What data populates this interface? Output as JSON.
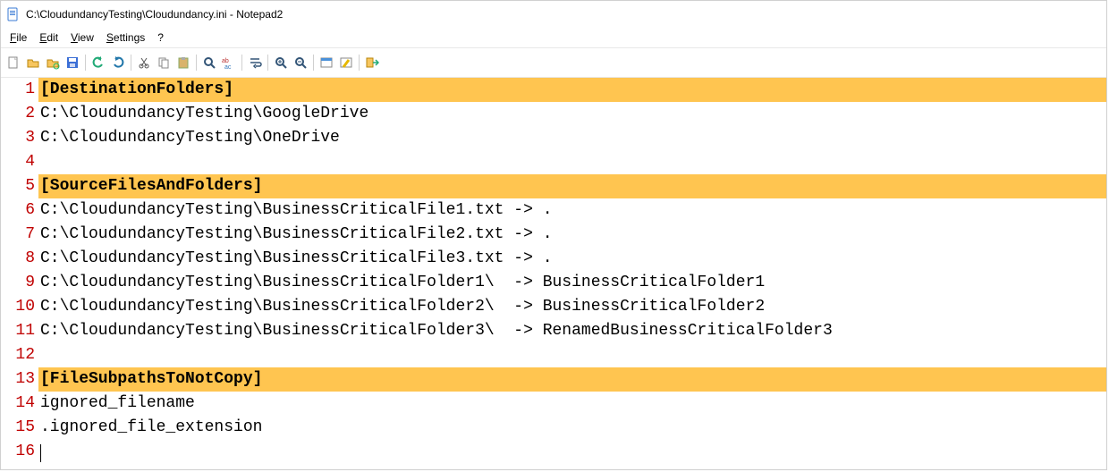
{
  "titlebar": {
    "title": "C:\\CloudundancyTesting\\Cloudundancy.ini - Notepad2"
  },
  "menubar": {
    "file": "File",
    "edit": "Edit",
    "view": "View",
    "settings": "Settings",
    "help": "?"
  },
  "tool_icons": {
    "new": "new-file-icon",
    "open": "open-file-icon",
    "browse": "browse-icon",
    "save": "save-icon",
    "undo": "undo-icon",
    "redo": "redo-icon",
    "cut": "cut-icon",
    "copy": "copy-icon",
    "paste": "paste-icon",
    "find": "find-icon",
    "replace": "replace-icon",
    "wordwrap": "wordwrap-icon",
    "zoom_in": "zoom-in-icon",
    "zoom_out": "zoom-out-icon",
    "scheme": "scheme-icon",
    "customize": "customize-icon",
    "exit": "exit-icon"
  },
  "lines": [
    {
      "n": "1",
      "t": "[DestinationFolders]",
      "section": true
    },
    {
      "n": "2",
      "t": "C:\\CloudundancyTesting\\GoogleDrive",
      "section": false
    },
    {
      "n": "3",
      "t": "C:\\CloudundancyTesting\\OneDrive",
      "section": false
    },
    {
      "n": "4",
      "t": "",
      "section": false
    },
    {
      "n": "5",
      "t": "[SourceFilesAndFolders]",
      "section": true
    },
    {
      "n": "6",
      "t": "C:\\CloudundancyTesting\\BusinessCriticalFile1.txt -> .",
      "section": false
    },
    {
      "n": "7",
      "t": "C:\\CloudundancyTesting\\BusinessCriticalFile2.txt -> .",
      "section": false
    },
    {
      "n": "8",
      "t": "C:\\CloudundancyTesting\\BusinessCriticalFile3.txt -> .",
      "section": false
    },
    {
      "n": "9",
      "t": "C:\\CloudundancyTesting\\BusinessCriticalFolder1\\  -> BusinessCriticalFolder1",
      "section": false
    },
    {
      "n": "10",
      "t": "C:\\CloudundancyTesting\\BusinessCriticalFolder2\\  -> BusinessCriticalFolder2",
      "section": false
    },
    {
      "n": "11",
      "t": "C:\\CloudundancyTesting\\BusinessCriticalFolder3\\  -> RenamedBusinessCriticalFolder3",
      "section": false
    },
    {
      "n": "12",
      "t": "",
      "section": false
    },
    {
      "n": "13",
      "t": "[FileSubpathsToNotCopy]",
      "section": true
    },
    {
      "n": "14",
      "t": "ignored_filename",
      "section": false
    },
    {
      "n": "15",
      "t": ".ignored_file_extension",
      "section": false
    },
    {
      "n": "16",
      "t": "",
      "section": false,
      "caret": true
    }
  ]
}
